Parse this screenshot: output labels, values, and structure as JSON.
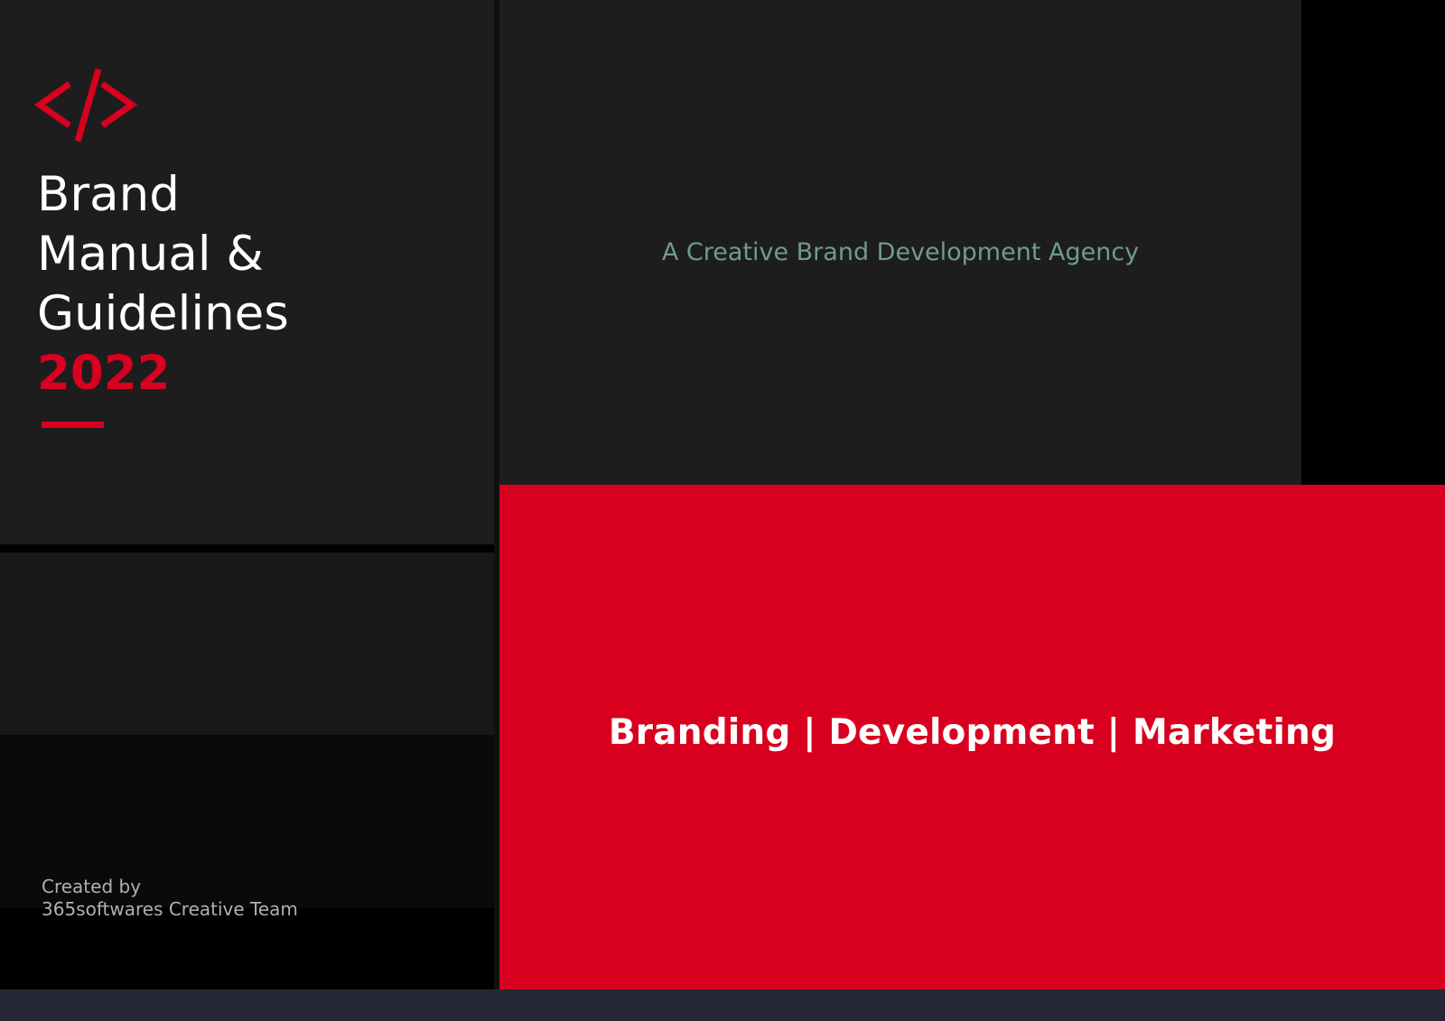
{
  "cover": {
    "logo_icon": "code-brackets-icon",
    "title_lines": [
      "Brand",
      "Manual &",
      "Guidelines"
    ],
    "year": "2022",
    "credit_label": "Created by",
    "credit_team": "365softwares Creative Team",
    "agency_tagline": "A Creative Brand Development Agency",
    "services_tagline": "Branding | Development | Marketing"
  },
  "colors": {
    "accent": "#d9001f",
    "dark_panel": "#1d1d1e",
    "tagline": "#6f9b8d"
  }
}
